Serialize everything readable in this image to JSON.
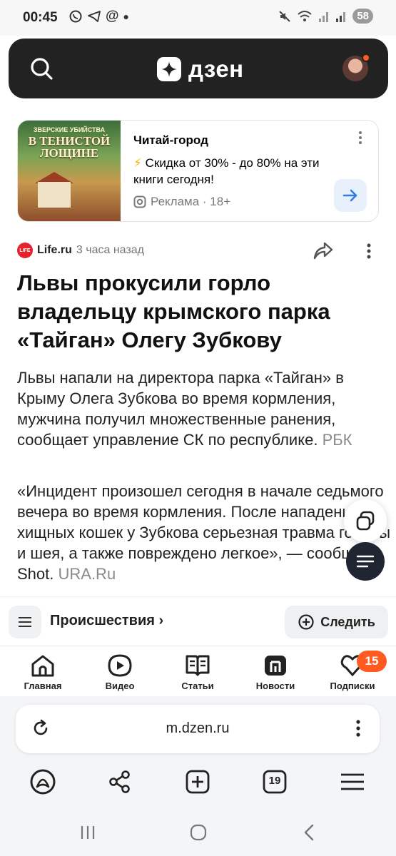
{
  "status_bar": {
    "time": "00:45",
    "left_icons": [
      "whatsapp-icon",
      "telegram-icon",
      "at-icon",
      "dot-icon"
    ],
    "right_icons": [
      "mute-icon",
      "wifi-icon",
      "signal-icon",
      "signal-icon"
    ],
    "battery": "58"
  },
  "header": {
    "logo_text": "дзен",
    "search_icon": "search-icon",
    "has_notification_dot": true
  },
  "ad": {
    "image_title_top": "ЗВЕРСКИЕ УБИЙСТВА",
    "image_title_main": "В ТЕНИСТОЙ ЛОЩИНЕ",
    "brand": "Читай-город",
    "text": "Скидка от 30% - до 80% на эти книги сегодня!",
    "meta": "Реклама · 18+"
  },
  "article": {
    "source_logo": "LIFE",
    "source": "Life.ru",
    "time": "3 часа назад",
    "headline": "Львы прокусили горло владельцу крымского парка «Тайган» Олегу Зубкову",
    "lead": "Львы напали на директора парка «Тайган» в Крыму Олега Зубкова во время кормления, мужчина получил множественные ранения, сообщает управление СК по республике.",
    "lead_source": "РБК",
    "quote": "«Инцидент произошел сегодня в начале седьмого вечера во время кормления. После нападения хищных кошек у Зубкова серьезная травма головы и шея, а также повреждено легкое», — сообщает Shot.",
    "quote_source": "URA.Ru"
  },
  "section_bar": {
    "title": "Происшествия ›",
    "follow_label": "Следить"
  },
  "tabs": [
    {
      "label": "Главная",
      "icon": "home-icon"
    },
    {
      "label": "Видео",
      "icon": "video-icon"
    },
    {
      "label": "Статьи",
      "icon": "articles-icon"
    },
    {
      "label": "Новости",
      "icon": "news-icon"
    },
    {
      "label": "Подписки",
      "icon": "subscriptions-icon"
    }
  ],
  "subscriptions_badge": "15",
  "browser": {
    "url": "m.dzen.ru",
    "tab_count": "19"
  },
  "colors": {
    "header_bg": "#222222",
    "accent_orange": "#ff5a1f",
    "ad_arrow": "#2f7de1",
    "source_red": "#e3222e"
  }
}
